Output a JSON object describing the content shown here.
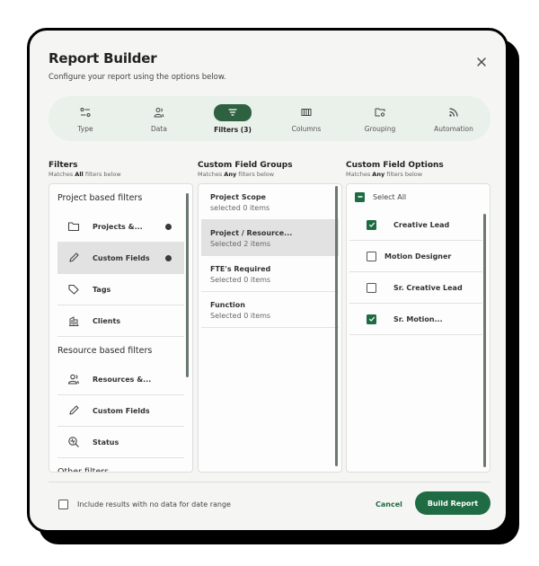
{
  "dialog": {
    "title": "Report Builder",
    "subtitle": "Configure your report using the options below.",
    "close_icon": "close-icon"
  },
  "tabs": [
    {
      "label": "Type",
      "icon": "type-sliders-icon",
      "active": false
    },
    {
      "label": "Data",
      "icon": "users-data-icon",
      "active": false
    },
    {
      "label": "Filters (3)",
      "icon": "filter-icon",
      "active": true
    },
    {
      "label": "Columns",
      "icon": "columns-icon",
      "active": false
    },
    {
      "label": "Grouping",
      "icon": "folder-settings-icon",
      "active": false
    },
    {
      "label": "Automation",
      "icon": "rss-icon",
      "active": false
    }
  ],
  "filters": {
    "heading": "Filters",
    "sub_prefix": "Matches ",
    "sub_bold": "All",
    "sub_suffix": " filters below",
    "groups": [
      {
        "title": "Project based filters",
        "items": [
          {
            "label": "Projects &...",
            "icon": "folder-icon",
            "has_dot": true,
            "selected": false
          },
          {
            "label": "Custom Fields",
            "icon": "pencil-icon",
            "has_dot": true,
            "selected": true
          },
          {
            "label": "Tags",
            "icon": "tag-icon",
            "has_dot": false,
            "selected": false
          },
          {
            "label": "Clients",
            "icon": "building-icon",
            "has_dot": false,
            "selected": false
          }
        ]
      },
      {
        "title": "Resource based filters",
        "items": [
          {
            "label": "Resources &...",
            "icon": "users-icon",
            "has_dot": false,
            "selected": false
          },
          {
            "label": "Custom Fields",
            "icon": "pencil-icon",
            "has_dot": false,
            "selected": false
          },
          {
            "label": "Status",
            "icon": "status-search-icon",
            "has_dot": false,
            "selected": false
          }
        ]
      },
      {
        "title": "Other filters",
        "items": []
      }
    ]
  },
  "field_groups": {
    "heading": "Custom Field Groups",
    "sub_prefix": "Matches ",
    "sub_bold": "Any",
    "sub_suffix": " filters below",
    "items": [
      {
        "title": "Project Scope",
        "status": "selected 0 items",
        "selected": false
      },
      {
        "title": "Project / Resource...",
        "status": "Selected 2 items",
        "selected": true
      },
      {
        "title": "FTE's Required",
        "status": "Selected 0 items",
        "selected": false
      },
      {
        "title": "Function",
        "status": "Selected 0 items",
        "selected": false
      }
    ]
  },
  "field_options": {
    "heading": "Custom Field Options",
    "sub_prefix": "Matches ",
    "sub_bold": "Any",
    "sub_suffix": " filters below",
    "select_all_label": "Select All",
    "select_all_state": "mixed",
    "items": [
      {
        "label": "Creative Lead",
        "checked": true
      },
      {
        "label": "Motion Designer",
        "checked": false
      },
      {
        "label": "Sr. Creative Lead",
        "checked": false
      },
      {
        "label": "Sr. Motion...",
        "checked": true
      }
    ]
  },
  "footer": {
    "include_no_data_label": "Include results with no data for date range",
    "include_no_data_checked": false,
    "cancel_label": "Cancel",
    "build_label": "Build Report"
  },
  "colors": {
    "accent": "#1f6b43",
    "active_tab": "#2e6140",
    "tabs_bg": "#e9f1ea",
    "card_bg": "#f5f5f3"
  }
}
